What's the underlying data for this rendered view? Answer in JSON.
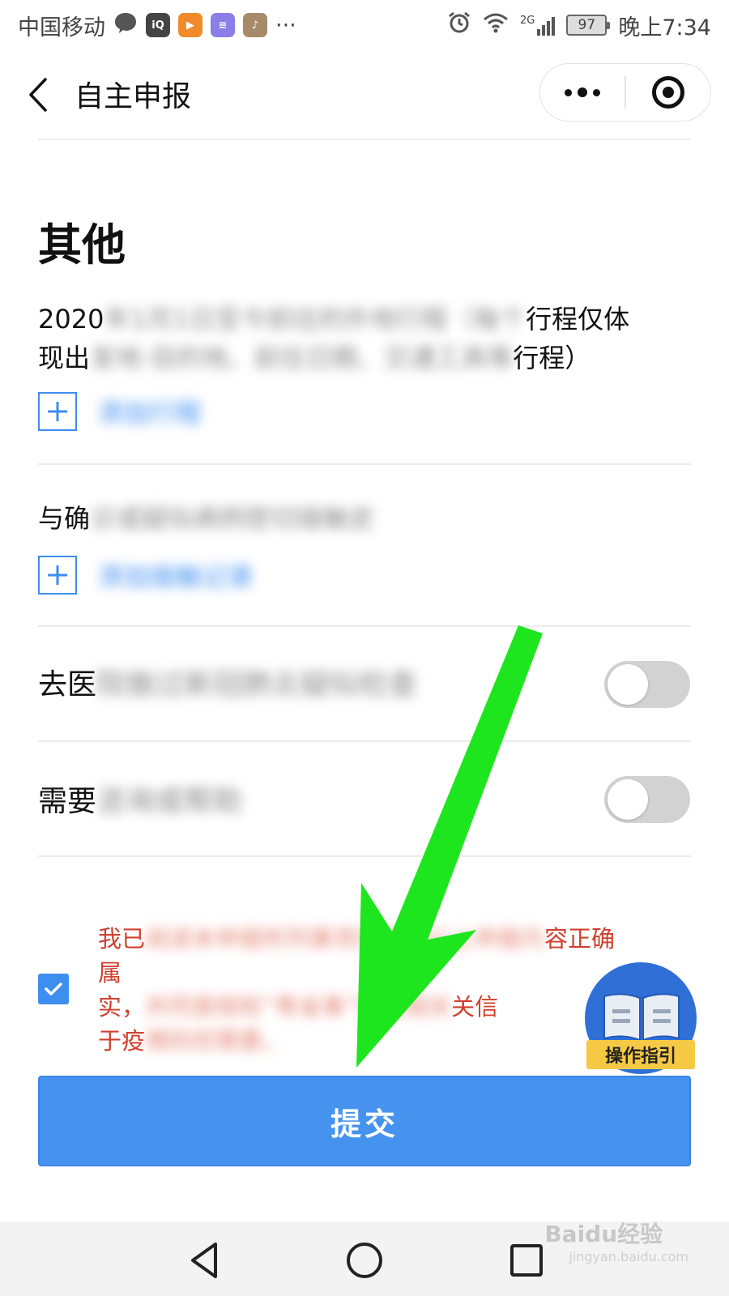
{
  "status_bar": {
    "carrier": "中国移动",
    "more": "···",
    "network": "2G",
    "battery": "97",
    "time": "晚上7:34"
  },
  "title_bar": {
    "title": "自主申报"
  },
  "section": {
    "title": "其他"
  },
  "questions": {
    "travel": {
      "line1_prefix": "2020",
      "line1_blur": "年1月1日至今前往的外地行程（每个",
      "line1_suffix": "行程仅体",
      "line2_prefix": "现出",
      "line2_blur": "发地·目的地、前往日期、交通工具等",
      "line2_suffix": "行程）",
      "add_label": "添加行程"
    },
    "contact": {
      "prefix": "与确",
      "blur": "诊或疑似病例密切接触史",
      "add_label": "添加接触记录"
    },
    "hospital": {
      "prefix": "去医",
      "blur": "院做过新冠肺炎疑似检查"
    },
    "help": {
      "prefix": "需要",
      "blur": "咨询或帮助"
    }
  },
  "agreement": {
    "line1_prefix": "我已",
    "line1_blur": "阅读本申报所列事项并承诺以上申报内",
    "line1_suffix": "容正确属",
    "line2_prefix": "实，",
    "line2_blur": "并同意授权“粤省事”获取相关",
    "line2_suffix": "关信",
    "line3_prefix": "于疫",
    "line3_blur": "情防控需要。"
  },
  "guide": {
    "label": "操作指引"
  },
  "submit": {
    "label": "提交"
  },
  "watermark": {
    "brand": "Baidu经验",
    "url": "jingyan.baidu.com"
  },
  "colors": {
    "accent": "#4593ee",
    "warning_text": "#d0402e",
    "annotation_arrow": "#1ee61e"
  }
}
